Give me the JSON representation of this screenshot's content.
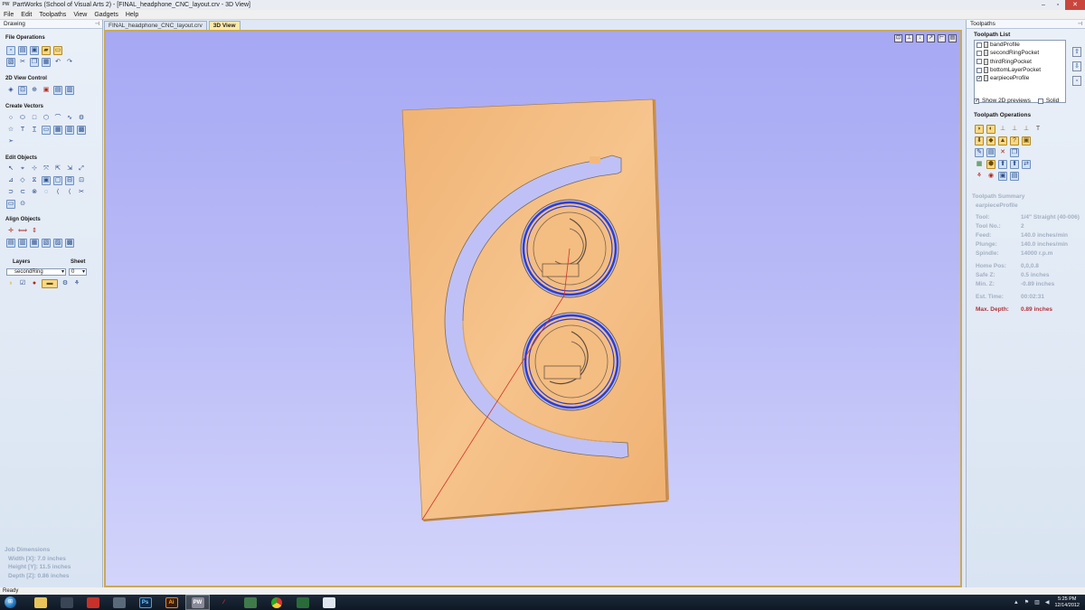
{
  "window": {
    "title": "PartWorks (School of Visual Arts 2) - [FINAL_headphone_CNC_layout.crv - 3D View]",
    "app_badge": "PW"
  },
  "menu": [
    "File",
    "Edit",
    "Toolpaths",
    "View",
    "Gadgets",
    "Help"
  ],
  "left_panel": {
    "header": "Drawing",
    "sections": {
      "file_ops": "File Operations",
      "view_control": "2D View Control",
      "create_vectors": "Create Vectors",
      "edit_objects": "Edit Objects",
      "align_objects": "Align Objects",
      "layers": "Layers",
      "sheet": "Sheet"
    },
    "layer_value": "secondRing",
    "sheet_value": "0",
    "job_dimensions": {
      "title": "Job Dimensions",
      "width": "Width  [X]: 7.0 inches",
      "height": "Height [Y]: 11.5 inches",
      "depth": "Depth  [Z]: 0.86 inches"
    }
  },
  "tabs": [
    {
      "label": "FINAL_headphone_CNC_layout.crv",
      "active": false
    },
    {
      "label": "3D View",
      "active": true
    }
  ],
  "right_panel": {
    "header": "Toolpaths",
    "list_title": "Toolpath List",
    "toolpaths": [
      {
        "label": "bandProfile",
        "checked": false
      },
      {
        "label": "secondRingPocket",
        "checked": false
      },
      {
        "label": "thirdRingPocket",
        "checked": false
      },
      {
        "label": "bottomLayerPocket",
        "checked": false
      },
      {
        "label": "earpieceProfile",
        "checked": true
      }
    ],
    "show_2d_previews": {
      "label": "Show 2D previews",
      "checked": true
    },
    "solid": {
      "label": "Solid",
      "checked": false
    },
    "ops_title": "Toolpath Operations",
    "summary": {
      "title": "Toolpath Summary",
      "name": "earpieceProfile",
      "rows": [
        {
          "k": "Tool:",
          "v": "1/4\" Straight (40-006)"
        },
        {
          "k": "Tool No.:",
          "v": "2"
        },
        {
          "k": "Feed:",
          "v": "140.0 inches/min"
        },
        {
          "k": "Plunge:",
          "v": "140.0 inches/min"
        },
        {
          "k": "Spindle:",
          "v": "14000 r.p.m"
        }
      ],
      "rows2": [
        {
          "k": "Home Pos:",
          "v": "0,0,0.8"
        },
        {
          "k": "Safe Z:",
          "v": "0.5 inches"
        },
        {
          "k": "Min. Z:",
          "v": "-0.89 inches"
        }
      ],
      "est_time": {
        "k": "Est. Time:",
        "v": "00:02:31"
      },
      "max_depth": {
        "k": "Max. Depth:",
        "v": "0.89 inches"
      }
    }
  },
  "status": "Ready",
  "taskbar": {
    "apps": [
      "",
      "",
      "",
      "",
      "Ps",
      "Ai",
      "PW",
      "",
      "",
      "",
      "",
      ""
    ],
    "time": "5:25 PM",
    "date": "12/14/2012"
  },
  "colors": {
    "wood": "#f2b97a",
    "toolpath": "#2a3ed6",
    "viewport_top": "#a6a8f4",
    "viewport_bottom": "#d3d4fb",
    "max_depth": "#b2343a"
  }
}
